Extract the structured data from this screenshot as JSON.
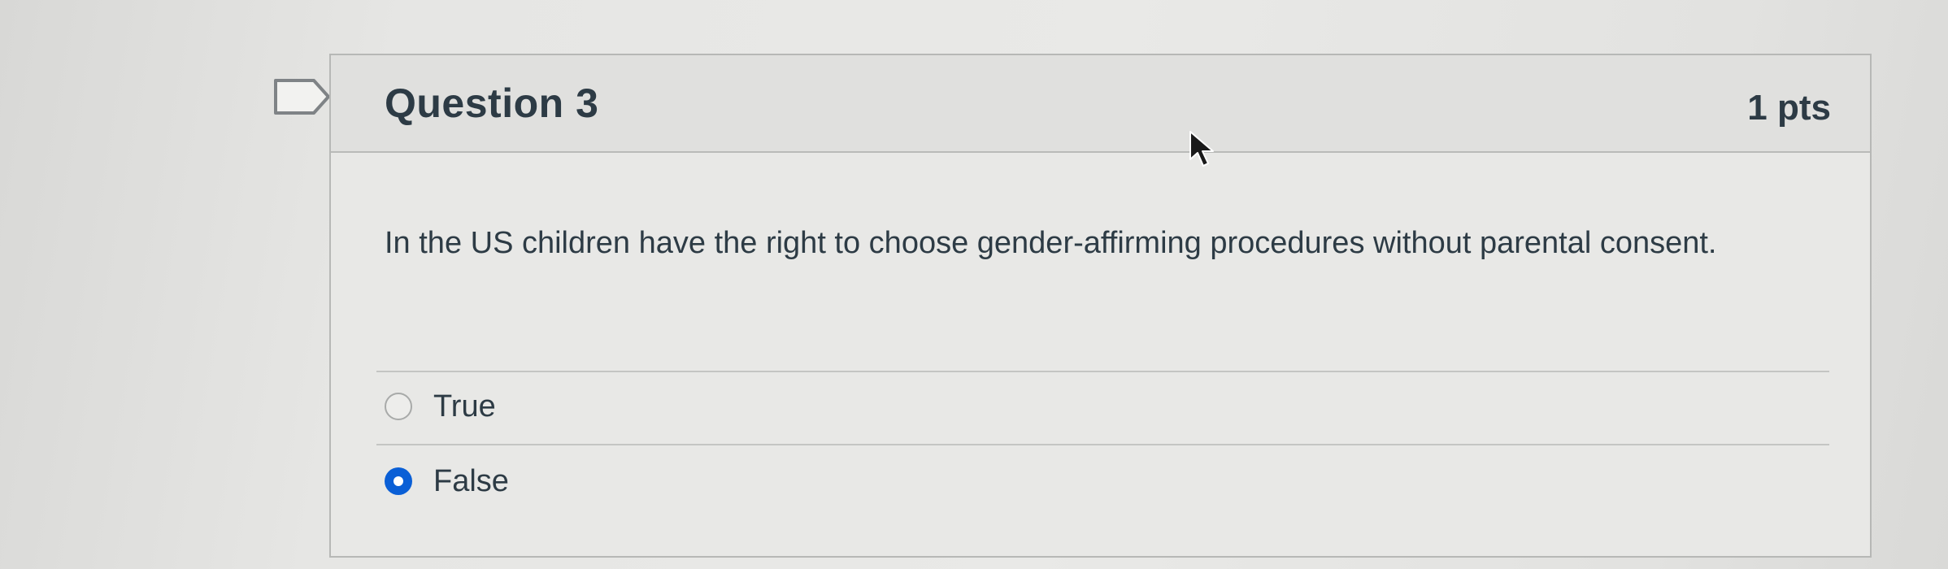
{
  "question": {
    "title": "Question 3",
    "points": "1 pts",
    "text": "In the US children have the right to choose gender-affirming procedures without parental consent.",
    "answers": [
      {
        "label": "True",
        "selected": false
      },
      {
        "label": "False",
        "selected": true
      }
    ]
  },
  "icons": {
    "flag": "bookmark-flag-icon",
    "radio_unselected": "radio-unselected-icon",
    "radio_selected": "radio-selected-icon",
    "cursor": "mouse-pointer-icon"
  },
  "colors": {
    "accent": "#0a5fd6",
    "text": "#2d3b45",
    "border": "#b7b8b6"
  }
}
